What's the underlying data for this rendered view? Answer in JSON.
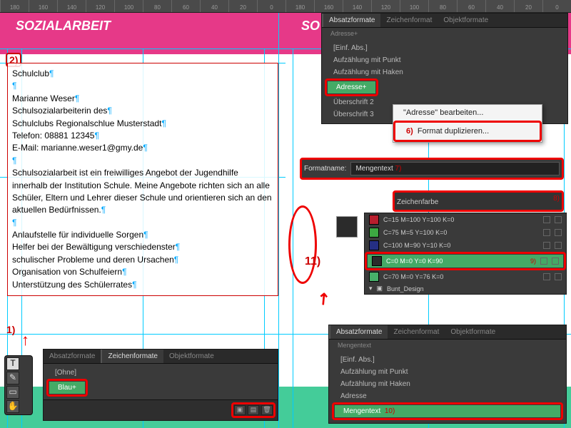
{
  "rulers": [
    "180",
    "160",
    "140",
    "120",
    "100",
    "80",
    "60",
    "40",
    "20",
    "0",
    "180",
    "160",
    "140",
    "120",
    "100",
    "80",
    "60",
    "40",
    "20",
    "0"
  ],
  "left": {
    "header": "SOZIALARBEIT",
    "marker2": "2)",
    "text": {
      "l1": "Schulclub",
      "l2": "Marianne Weser",
      "l3": "Schulsozialarbeiterin des",
      "l4": "Schulclubs Regionalschlue Musterstadt",
      "l5": "Telefon: 08881 12345",
      "l6": "E-Mail: marianne.weser1@gmy.de",
      "p1": "Schulsozialarbeit ist ein freiwilliges Angebot der Jugendhilfe innerhalb der Institution Schule. Meine Angebote richten sich an alle Schüler, Eltern und Lehrer dieser Schule und orientieren sich an den aktuellen Bedürfnissen.",
      "b1": "Anlaufstelle für individuelle Sorgen",
      "b2": "Helfer bei der Bewältigung verschiedenster",
      "b3": "schulischer Probleme und deren Ursachen",
      "b4": "Organisation von Schulfeiern",
      "b5": "Unterstützung des Schülerrates"
    },
    "panel": {
      "tabs": [
        "Absatzformate",
        "Zeichenformate",
        "Objektformate"
      ],
      "none": "[Ohne]",
      "blau": "Blau+"
    },
    "marker1": "1)"
  },
  "right": {
    "header": "SO",
    "panelTop": {
      "tabs": [
        "Absatzformate",
        "Zeichenformat",
        "Objektformate"
      ],
      "crumb": "Adresse+",
      "rows": [
        "[Einf. Abs.]",
        "Aufzählung mit Punkt",
        "Aufzählung mit Haken",
        "Adresse+",
        "Überschrift 2",
        "Überschrift 3"
      ]
    },
    "ctx": {
      "edit": "\"Adresse\" bearbeiten...",
      "dup": "Format duplizieren...",
      "m6": "6)"
    },
    "name": {
      "label": "Formatname:",
      "value": "Mengentext",
      "m7": "7)"
    },
    "color": {
      "label": "Zeichenfarbe",
      "m8": "8)"
    },
    "swatches": [
      {
        "n": "C=15 M=100 Y=100 K=0",
        "c": "#b81e2d"
      },
      {
        "n": "C=75 M=5 Y=100 K=0",
        "c": "#3da742"
      },
      {
        "n": "C=100 M=90 Y=10 K=0",
        "c": "#252f84"
      },
      {
        "n": "C=0 M=0 Y=0 K=90",
        "c": "#2b2b2b"
      },
      {
        "n": "C=70 M=0 Y=76 K=0",
        "c": "#47b06a"
      }
    ],
    "folder": "Bunt_Design",
    "m9": "9)",
    "panelBot": {
      "tabs": [
        "Absatzformate",
        "Zeichenformat",
        "Objektformate"
      ],
      "crumb": "Mengentext",
      "rows": [
        "[Einf. Abs.]",
        "Aufzählung mit Punkt",
        "Aufzählung mit Haken",
        "Adresse",
        "Mengentext"
      ],
      "m10": "10)"
    },
    "marker11": "11)"
  }
}
